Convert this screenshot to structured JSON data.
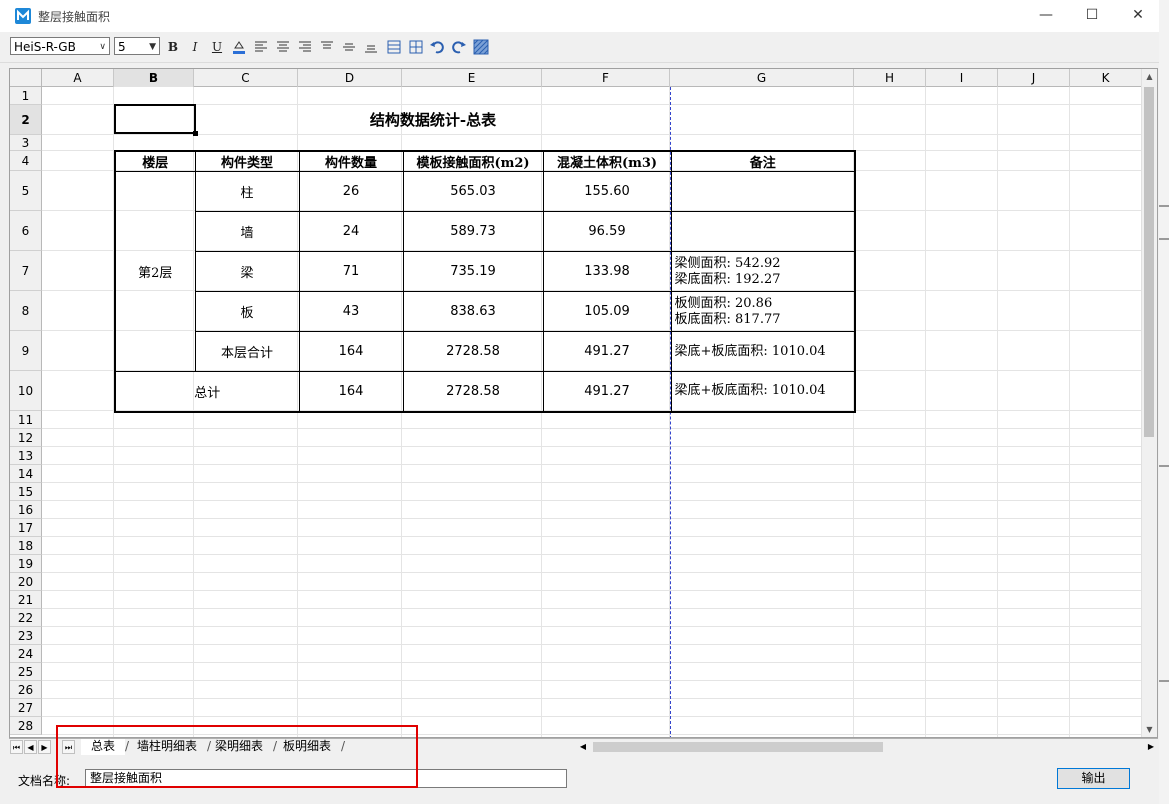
{
  "window": {
    "title": "整层接触面积",
    "controls": {
      "minimize": "—",
      "maximize": "☐",
      "close": "✕"
    }
  },
  "toolbar": {
    "font_name": "HeiS-R-GB",
    "font_size": "5",
    "buttons": {
      "bold": "B",
      "italic": "I",
      "underline": "U"
    }
  },
  "sheet": {
    "columns": [
      "A",
      "B",
      "C",
      "D",
      "E",
      "F",
      "G",
      "H",
      "I",
      "J",
      "K"
    ],
    "rows": [
      "1",
      "2",
      "3",
      "4",
      "5",
      "6",
      "7",
      "8",
      "9",
      "10",
      "11",
      "12",
      "13",
      "14",
      "15",
      "16",
      "17",
      "18",
      "19",
      "20",
      "21",
      "22",
      "23",
      "24",
      "25",
      "26",
      "27",
      "28"
    ],
    "selected_cell": "B2"
  },
  "report": {
    "title": "结构数据统计-总表",
    "headers": [
      "楼层",
      "构件类型",
      "构件数量",
      "模板接触面积(m2)",
      "混凝土体积(m3)",
      "备注"
    ],
    "floor": "第2层",
    "rows": [
      {
        "type": "柱",
        "count": "26",
        "area": "565.03",
        "volume": "155.60",
        "note1": "",
        "note2": ""
      },
      {
        "type": "墙",
        "count": "24",
        "area": "589.73",
        "volume": "96.59",
        "note1": "",
        "note2": ""
      },
      {
        "type": "梁",
        "count": "71",
        "area": "735.19",
        "volume": "133.98",
        "note1": "梁侧面积: 542.92",
        "note2": "梁底面积: 192.27"
      },
      {
        "type": "板",
        "count": "43",
        "area": "838.63",
        "volume": "105.09",
        "note1": "板侧面积: 20.86",
        "note2": "板底面积: 817.77"
      },
      {
        "type": "本层合计",
        "count": "164",
        "area": "2728.58",
        "volume": "491.27",
        "note1": "梁底+板底面积: 1010.04",
        "note2": ""
      }
    ],
    "total": {
      "label": "总计",
      "count": "164",
      "area": "2728.58",
      "volume": "491.27",
      "note": "梁底+板底面积: 1010.04"
    }
  },
  "tabs": [
    "总表",
    "墙柱明细表",
    "梁明细表",
    "板明细表"
  ],
  "active_tab": "总表",
  "footer": {
    "doc_name_label": "文档名称:",
    "doc_name_value": "整层接触面积",
    "export_button": "输出"
  },
  "colors": {
    "highlight": "#e00000",
    "page_break": "#3344cc",
    "accent": "#0078d7"
  }
}
